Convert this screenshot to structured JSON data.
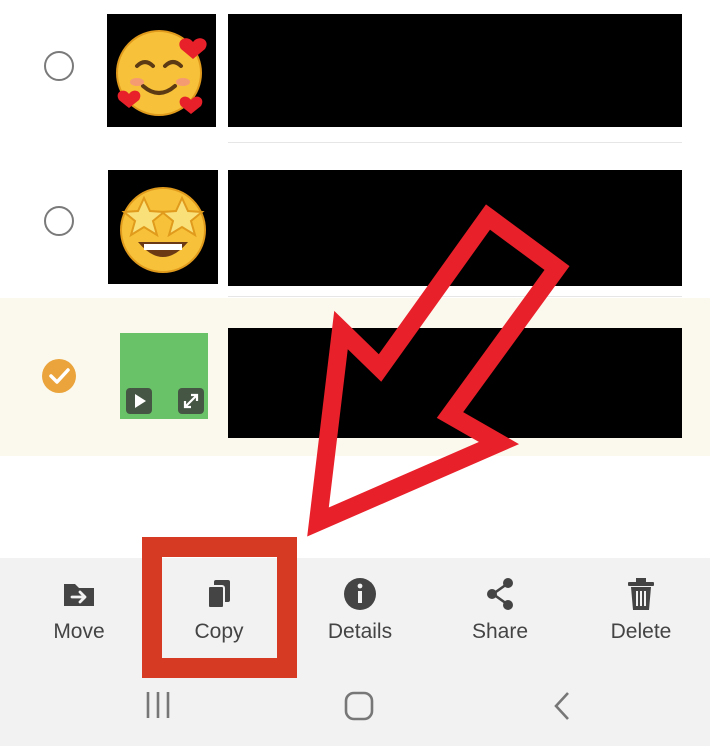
{
  "messages": [
    {
      "emoji": "smiling-face-with-hearts",
      "selected": false
    },
    {
      "emoji": "star-struck",
      "selected": false
    },
    {
      "emoji": "video-thumbnail",
      "selected": true
    }
  ],
  "toolbar": {
    "move_label": "Move",
    "copy_label": "Copy",
    "details_label": "Details",
    "share_label": "Share",
    "delete_label": "Delete"
  },
  "colors": {
    "selection_accent": "#eaa43b",
    "annotation_red": "#e8202a",
    "highlight_box": "#d63a22",
    "toolbar_bg": "#f2f2f2"
  },
  "icons": {
    "move": "folder-arrow-icon",
    "copy": "copy-icon",
    "details": "info-icon",
    "share": "share-icon",
    "delete": "trash-icon",
    "nav_recents": "recent-apps-icon",
    "nav_home": "home-icon",
    "nav_back": "back-icon"
  }
}
